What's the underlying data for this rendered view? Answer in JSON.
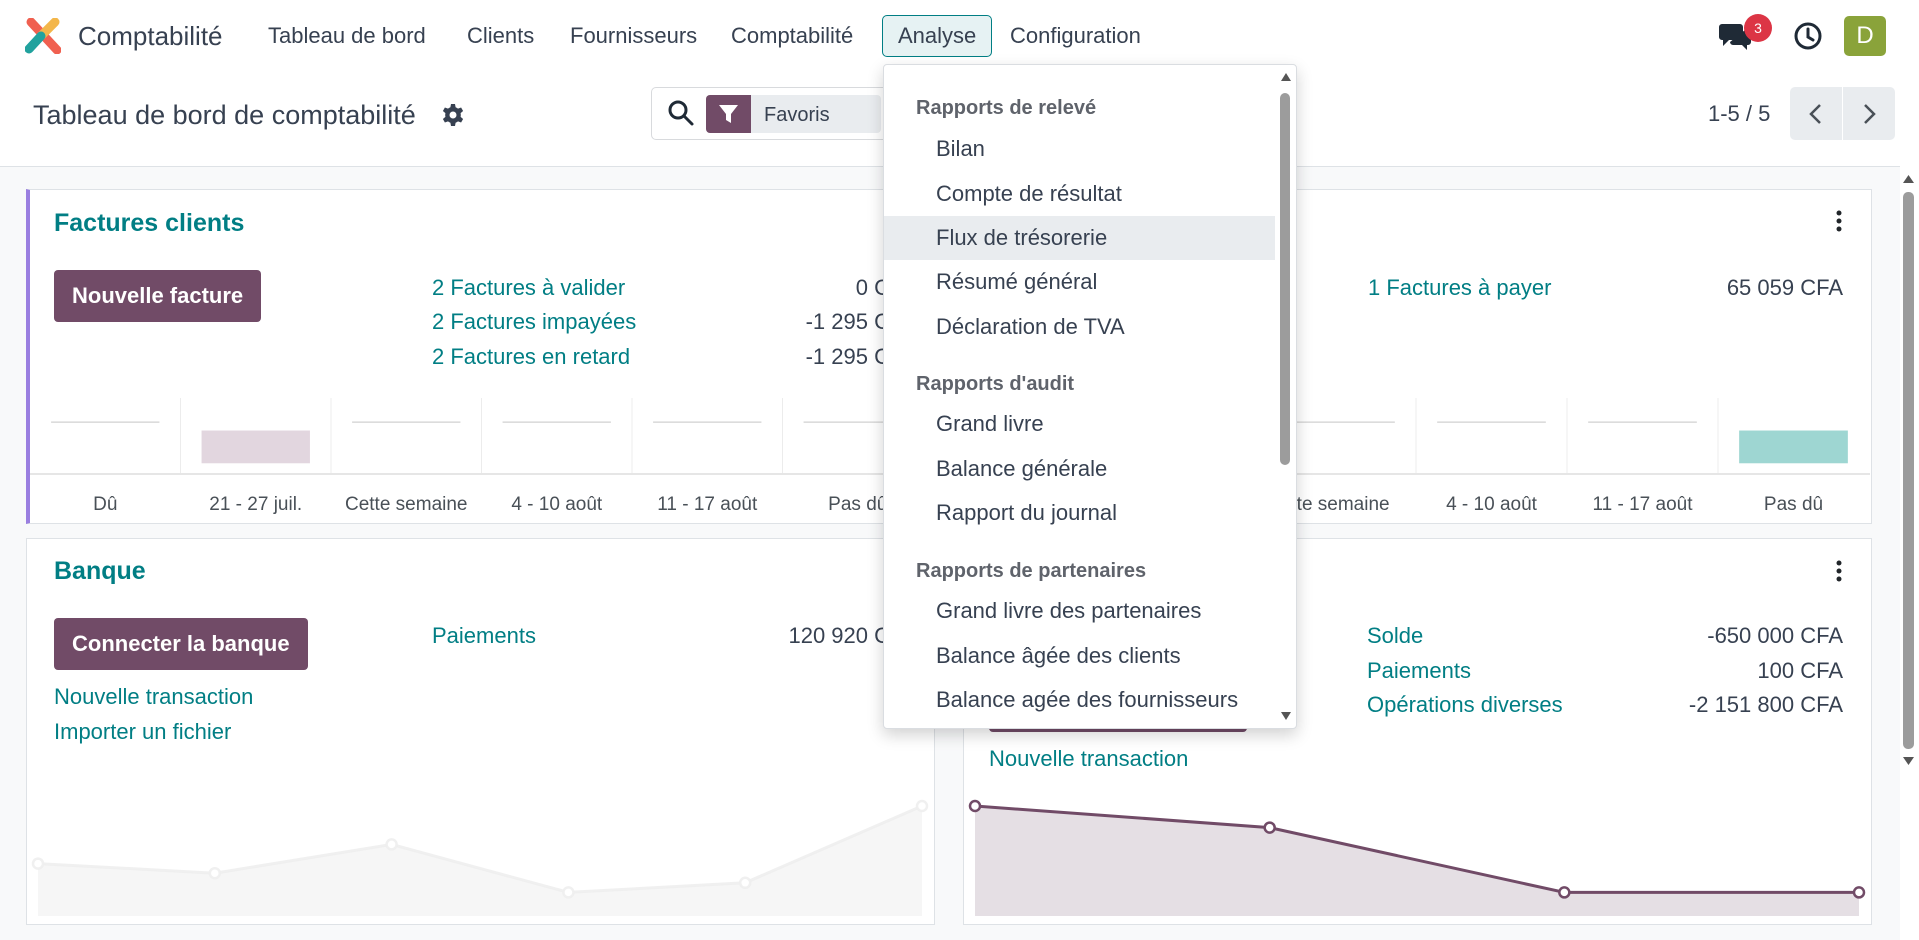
{
  "navbar": {
    "app_name": "Comptabilité",
    "menu": [
      "Tableau de bord",
      "Clients",
      "Fournisseurs",
      "Comptabilité",
      "Analyse",
      "Configuration"
    ],
    "active_menu": "Analyse",
    "chat_badge": "3",
    "avatar_initial": "D",
    "icons": [
      "logo-icon",
      "chat-icon",
      "clock-icon"
    ]
  },
  "control_panel": {
    "title": "Tableau de bord de comptabilité",
    "filter_label": "Favoris",
    "pager": "1-5 / 5"
  },
  "cards": {
    "customer_invoices": {
      "title": "Factures clients",
      "button": "Nouvelle facture",
      "links": [
        "2 Factures à valider",
        "2 Factures impayées",
        "2 Factures en retard"
      ],
      "amounts": [
        "0 C",
        "-1 295 C",
        "-1 295 C"
      ],
      "axis": [
        "Dû",
        "21 - 27 juil.",
        "Cette semaine",
        "4 - 10 août",
        "11 - 17 août",
        "Pas dû"
      ]
    },
    "vendor_bills": {
      "link": "1 Factures à payer",
      "amount": "65 059 CFA",
      "axis": [
        "tte semaine",
        "4 - 10 août",
        "11 - 17 août",
        "Pas dû"
      ]
    },
    "bank": {
      "title": "Banque",
      "button": "Connecter la banque",
      "links": [
        "Nouvelle transaction",
        "Importer un fichier"
      ],
      "stat_label": "Paiements",
      "stat_amount": "120 920 C"
    },
    "cash": {
      "link": "Nouvelle transaction",
      "stats": [
        {
          "label": "Solde",
          "amount": "-650 000 CFA"
        },
        {
          "label": "Paiements",
          "amount": "100 CFA"
        },
        {
          "label": "Opérations diverses",
          "amount": "-2 151 800 CFA"
        }
      ]
    }
  },
  "chart_data": [
    {
      "type": "bar",
      "categories": [
        "Dû",
        "21 - 27 juil.",
        "Cette semaine",
        "4 - 10 août",
        "11 - 17 août",
        "Pas dû"
      ],
      "values": [
        0,
        1295,
        0,
        0,
        0,
        0
      ],
      "color": "#e2d6df"
    },
    {
      "type": "bar",
      "categories": [
        "tte semaine",
        "4 - 10 août",
        "11 - 17 août",
        "Pas dû"
      ],
      "values": [
        0,
        0,
        0,
        65059
      ],
      "color": "#9ed6d2"
    },
    {
      "type": "area",
      "values": [
        3,
        2,
        5,
        0,
        1,
        9
      ],
      "color": "#eeeeee"
    },
    {
      "type": "area",
      "values": [
        100,
        80,
        20,
        20
      ],
      "color": "#714b67"
    }
  ],
  "dropdown": {
    "sections": [
      {
        "header": "Rapports de relevé",
        "items": [
          "Bilan",
          "Compte de résultat",
          "Flux de trésorerie",
          "Résumé général",
          "Déclaration de TVA"
        ]
      },
      {
        "header": "Rapports d'audit",
        "items": [
          "Grand livre",
          "Balance générale",
          "Rapport du journal"
        ]
      },
      {
        "header": "Rapports de partenaires",
        "items": [
          "Grand livre des partenaires",
          "Balance âgée des clients",
          "Balance agée des fournisseurs"
        ]
      }
    ],
    "hovered": "Flux de trésorerie"
  },
  "colors": {
    "primary": "#714b67",
    "link": "#017e84",
    "badge": "#dc3545"
  }
}
